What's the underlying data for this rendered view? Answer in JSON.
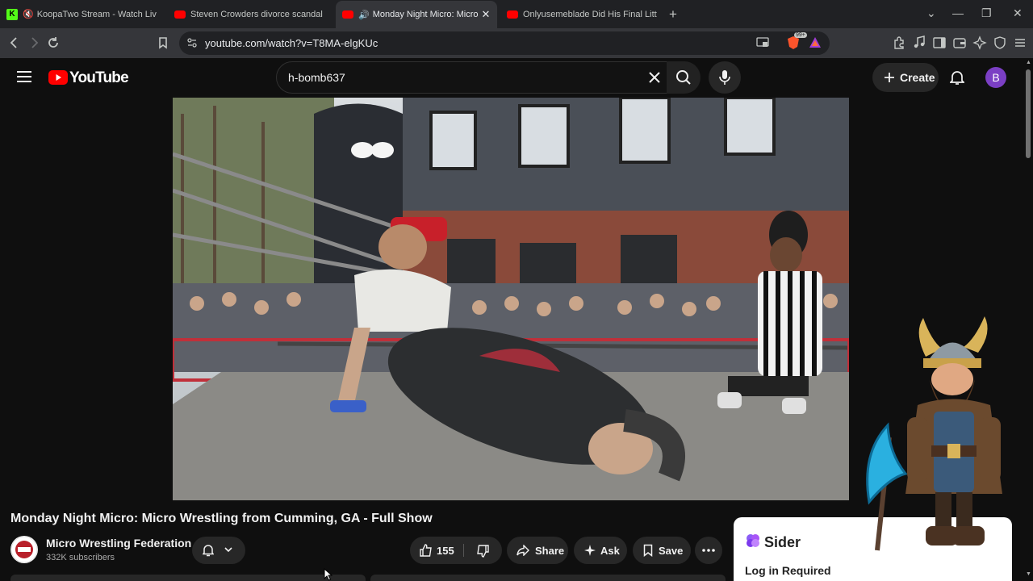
{
  "browser": {
    "tabs": [
      {
        "title": "KoopaTwo Stream - Watch Live o",
        "active": false
      },
      {
        "title": "Steven Crowders divorce scandal | RE",
        "active": false
      },
      {
        "title": "Monday Night Micro: Micro W",
        "active": true
      },
      {
        "title": "Onlyusemeblade Did His Final Litty S",
        "active": false
      }
    ],
    "url": "youtube.com/watch?v=T8MA-elgKUc",
    "badge_count": "99+"
  },
  "youtube": {
    "logo_text": "YouTube",
    "search_value": "h-bomb637",
    "create_label": "Create",
    "account_initial": "B"
  },
  "video": {
    "title": "Monday Night Micro: Micro Wrestling from Cumming, GA - Full Show",
    "channel": "Micro Wrestling Federation",
    "subscribers": "332K subscribers",
    "likes": "155",
    "share_label": "Share",
    "ask_label": "Ask",
    "save_label": "Save"
  },
  "sider": {
    "name": "Sider",
    "login": "Log in Required"
  },
  "colors": {
    "youtube_red": "#ff0000",
    "brave_orange": "#fb542b",
    "avatar_purple": "#7b3fc4"
  }
}
